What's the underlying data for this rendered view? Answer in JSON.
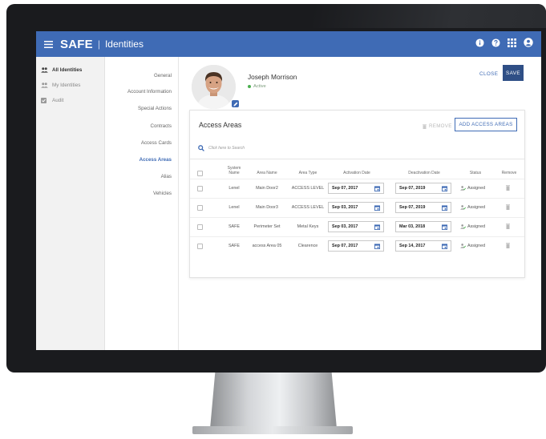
{
  "app": {
    "brand": "SAFE",
    "separator": "|",
    "section": "Identities"
  },
  "left_nav": {
    "items": [
      {
        "label": "All Identities",
        "active": true,
        "icon": "users-icon"
      },
      {
        "label": "My Identities",
        "active": false,
        "icon": "users-icon"
      },
      {
        "label": "Audit",
        "active": false,
        "icon": "checkbox-icon"
      }
    ]
  },
  "sub_nav": {
    "items": [
      {
        "label": "General",
        "active": false
      },
      {
        "label": "Account Information",
        "active": false
      },
      {
        "label": "Special Actions",
        "active": false
      },
      {
        "label": "Contracts",
        "active": false
      },
      {
        "label": "Access Cards",
        "active": false
      },
      {
        "label": "Access Areas",
        "active": true
      },
      {
        "label": "Alias",
        "active": false
      },
      {
        "label": "Vehicles",
        "active": false
      }
    ]
  },
  "profile": {
    "name": "Joseph Morrison",
    "status": "Active"
  },
  "actions": {
    "close_label": "CLOSE",
    "save_label": "SAVE"
  },
  "card": {
    "title": "Access Areas",
    "remove_label": "REMOVE",
    "add_label": "ADD ACCESS AREAS",
    "search_placeholder": "Click here to Search"
  },
  "table": {
    "headers": {
      "system_line1": "System",
      "system_line2": "Name",
      "area_name": "Area Name",
      "area_type": "Area Type",
      "activation": "Activation Date",
      "deactivation": "Deactivation Date",
      "status": "Status",
      "remove": "Remove"
    },
    "rows": [
      {
        "system": "Lenel",
        "area": "Main Door2",
        "type": "ACCESS LEVEL",
        "activation": "Sep 07, 2017",
        "deactivation": "Sep 07, 2019",
        "status": "Assigned"
      },
      {
        "system": "Lenel",
        "area": "Main Door3",
        "type": "ACCESS LEVEL",
        "activation": "Sep 03, 2017",
        "deactivation": "Sep 07, 2019",
        "status": "Assigned"
      },
      {
        "system": "SAFE",
        "area": "Perimeter Set",
        "type": "Metal Keys",
        "activation": "Sep 03, 2017",
        "deactivation": "Mar 03, 2018",
        "status": "Assigned"
      },
      {
        "system": "SAFE",
        "area": "access Area 05",
        "type": "Clearence",
        "activation": "Sep 07, 2017",
        "deactivation": "Sep 14, 2017",
        "status": "Assigned"
      }
    ]
  },
  "colors": {
    "primary": "#3f6bb5",
    "save_button": "#2f4f86",
    "active_dot": "#4caf50"
  }
}
